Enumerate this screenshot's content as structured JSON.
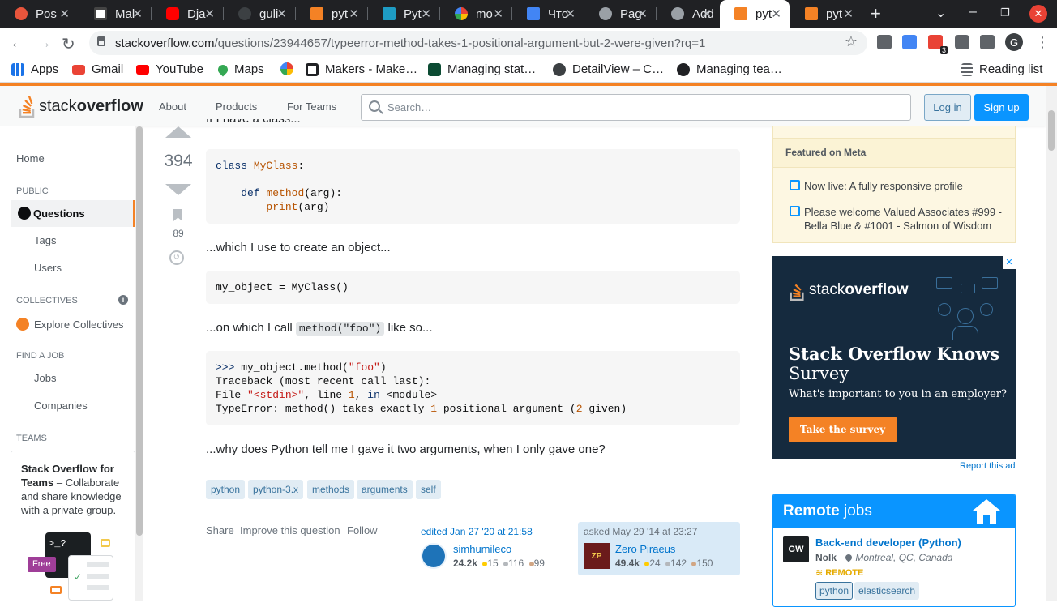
{
  "browser": {
    "tabs": [
      {
        "title": "Pos",
        "icon": "app-icon",
        "color": "#e8553c"
      },
      {
        "title": "Mal",
        "icon": "makers-icon",
        "color": "#ffffff"
      },
      {
        "title": "Dja",
        "icon": "youtube-icon",
        "color": "#ff0000"
      },
      {
        "title": "guli",
        "icon": "github-icon",
        "color": "#3c4043"
      },
      {
        "title": "pyt",
        "icon": "stackoverflow-icon",
        "color": "#f48225"
      },
      {
        "title": "Pyt",
        "icon": "image-icon",
        "color": "#1e9cc4"
      },
      {
        "title": "mo",
        "icon": "google-icon",
        "color": "#ffffff"
      },
      {
        "title": "Что",
        "icon": "docs-icon",
        "color": "#4285f4"
      },
      {
        "title": "Pag",
        "icon": "globe-icon",
        "color": "#9aa0a6"
      },
      {
        "title": "Add",
        "icon": "globe-icon",
        "color": "#9aa0a6"
      },
      {
        "title": "pyt",
        "icon": "stackoverflow-icon",
        "color": "#f48225"
      },
      {
        "title": "pyt",
        "icon": "stackoverflow-icon",
        "color": "#f48225"
      }
    ],
    "active_tab": 10,
    "url_host": "stackoverflow.com",
    "url_path": "/questions/23944657/typeerror-method-takes-1-positional-argument-but-2-were-given?rq=1",
    "extension_badge": "3",
    "profile_initial": "G",
    "bookmarks": [
      {
        "label": "Apps",
        "icon": "apps-grid-icon"
      },
      {
        "label": "Gmail",
        "icon": "gmail-icon"
      },
      {
        "label": "YouTube",
        "icon": "youtube-icon"
      },
      {
        "label": "Maps",
        "icon": "maps-pin-icon"
      },
      {
        "label": "",
        "icon": "google-icon"
      },
      {
        "label": "Makers - Make…",
        "icon": "makers-icon"
      },
      {
        "label": "Managing stat…",
        "icon": "django-icon"
      },
      {
        "label": "DetailView – C…",
        "icon": "globe-icon"
      },
      {
        "label": "Managing tea…",
        "icon": "github-icon"
      }
    ],
    "reading_list": "Reading list"
  },
  "so_header": {
    "logo_text_light": "stack",
    "logo_text_bold": "overflow",
    "nav": [
      "About",
      "Products",
      "For Teams"
    ],
    "search_placeholder": "Search…",
    "login": "Log in",
    "signup": "Sign up"
  },
  "leftnav": {
    "home": "Home",
    "public_header": "PUBLIC",
    "questions": "Questions",
    "tags": "Tags",
    "users": "Users",
    "collectives_header": "COLLECTIVES",
    "explore_collectives": "Explore Collectives",
    "find_job_header": "FIND A JOB",
    "jobs": "Jobs",
    "companies": "Companies",
    "teams_header": "TEAMS",
    "teams_title": "Stack Overflow for Teams",
    "teams_text": " – Collaborate and share knowledge with a private group.",
    "free_badge": "Free",
    "terminal_prompt": ">_?"
  },
  "question": {
    "intro_text": "If I have a class...",
    "score": "394",
    "bookmark_count": "89",
    "code1_line1_kw": "class",
    "code1_line1_name": "MyClass",
    "code1_line1_rest": ":",
    "code1_line3_kw": "def",
    "code1_line3_name": "method",
    "code1_line3_rest": "(arg):",
    "code1_line4_name": "print",
    "code1_line4_rest": "(arg)",
    "para2": "...which I use to create an object...",
    "code2": "my_object = MyClass()",
    "para3_before": "...on which I call ",
    "para3_code": "method(\"foo\")",
    "para3_after": " like so...",
    "code3_l1_prompt": ">>>",
    "code3_l1_call": " my_object.method(",
    "code3_l1_str": "\"foo\"",
    "code3_l1_end": ")",
    "code3_l2": "Traceback (most recent call last):",
    "code3_l3_a": "File ",
    "code3_l3_str": "\"<stdin>\"",
    "code3_l3_b": ", line ",
    "code3_l3_num": "1",
    "code3_l3_c": ", ",
    "code3_l3_kw": "in",
    "code3_l3_d": " <module>",
    "code3_l4_a": "TypeError: method() takes exactly ",
    "code3_l4_num1": "1",
    "code3_l4_b": " positional argument (",
    "code3_l4_num2": "2",
    "code3_l4_c": " given)",
    "para4": "...why does Python tell me I gave it two arguments, when I only gave one?",
    "tags": [
      "python",
      "python-3.x",
      "methods",
      "arguments",
      "self"
    ],
    "actions": [
      "Share",
      "Improve this question",
      "Follow"
    ],
    "edited": {
      "label": "edited Jan 27 '20 at 21:58",
      "user": "simhumileco",
      "rep": "24.2k",
      "gold": "15",
      "silver": "116",
      "bronze": "99"
    },
    "asked": {
      "label": "asked May 29 '14 at 23:27",
      "user": "Zero Piraeus",
      "avatar_text": "ZP",
      "rep": "49.4k",
      "gold": "24",
      "silver": "142",
      "bronze": "150"
    }
  },
  "sidebar": {
    "meta_header": "Featured on Meta",
    "meta_items": [
      "Now live: A fully responsive profile",
      "Please welcome Valued Associates #999 - Bella Blue & #1001 - Salmon of Wisdom"
    ],
    "ad": {
      "logo_light": "stack",
      "logo_bold": "overflow",
      "headline_bold": "Stack Overflow Knows",
      "headline_light": "Survey",
      "subtext": "What's important to you in an employer?",
      "cta": "Take the survey",
      "close": "✕"
    },
    "report_ad": "Report this ad",
    "jobs": {
      "title_bold": "Remote",
      "title_light": " jobs",
      "job_title": "Back-end developer (Python)",
      "company_logo": "GW",
      "company": "Nolk",
      "location": "Montreal, QC, Canada",
      "remote": "REMOTE",
      "tags": [
        "python",
        "elasticsearch"
      ]
    }
  },
  "colors": {
    "so_orange": "#f48225",
    "so_blue": "#0a95ff",
    "link": "#0074cc",
    "gold": "#ffcc01",
    "silver": "#b4b8bc",
    "bronze": "#d1a684"
  }
}
